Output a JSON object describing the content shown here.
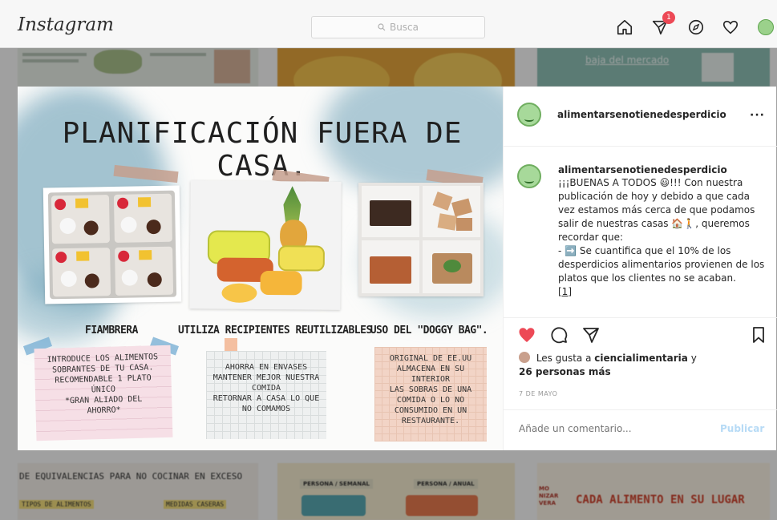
{
  "app": {
    "logo": "Instagram"
  },
  "search": {
    "placeholder": "Busca",
    "icon": "search-icon"
  },
  "nav": {
    "icons": [
      "home-icon",
      "direct-icon",
      "explore-icon",
      "activity-heart-icon",
      "profile-avatar"
    ],
    "direct_badge": "1"
  },
  "post": {
    "image": {
      "headline": "PLANIFICACIÓN FUERA DE CASA.",
      "columns": [
        {
          "title": "FIAMBRERA",
          "note": "INTRODUCE LOS ALIMENTOS\nSOBRANTES DE TU CASA.\nRECOMENDABLE 1 PLATO\nÚNICO\n*GRAN ALIADO DEL\nAHORRO*"
        },
        {
          "title": "UTILIZA RECIPIENTES REUTILIZABLES",
          "note": "AHORRA EN ENVASES\nMANTENER MEJOR NUESTRA\nCOMIDA\nRETORNAR A CASA LO QUE\nNO COMAMOS"
        },
        {
          "title": "USO DEL \"DOGGY BAG\".",
          "note": "ORIGINAL DE EE.UU\nALMACENA EN SU INTERIOR\nLAS SOBRAS DE UNA\nCOMIDA O LO NO\nCONSUMIDO EN UN\nRESTAURANTE."
        }
      ]
    },
    "header": {
      "username": "alimentarsenotienedesperdicio",
      "more_label": "···"
    },
    "caption": {
      "username": "alimentarsenotienedesperdicio",
      "line1": "¡¡¡BUENAS A TODOS 😃!!! Con nuestra publicación de hoy y debido a que cada vez estamos más cerca de que podamos salir de nuestras casas 🏠🚶, queremos recordar que:",
      "line2": "- ➡️ Se cuantifica que el 10% de los desperdicios alimentarios provienen de los platos que los clientes no se acaban.",
      "line3": "[1]"
    },
    "actions": [
      "heart-filled-icon",
      "comment-icon",
      "share-icon",
      "bookmark-icon"
    ],
    "likes": {
      "prefix": "Les gusta a",
      "user": "ciencialimentaria",
      "middle": "y",
      "others": "26 personas más"
    },
    "date": "7 DE MAYO",
    "comment": {
      "placeholder": "Añade un comentario...",
      "publish_label": "Publicar"
    }
  },
  "background": {
    "tiles": [
      {
        "text": "baja del mercado"
      },
      {
        "text": "DE EQUIVALENCIAS PARA NO COCINAR EN EXCESO"
      },
      {
        "text": "TIPOS DE ALIMENTOS"
      },
      {
        "text": "MEDIDAS CASERAS"
      },
      {
        "text": "PERSONA / SEMANAL"
      },
      {
        "text": "PERSONA / ANUAL"
      },
      {
        "text": "CADA ALIMENTO EN SU LUGAR"
      },
      {
        "text": "MO NIZAR VERA"
      }
    ]
  },
  "colors": {
    "like_red": "#ed4956",
    "badge_red": "#ed4956",
    "publish_blue": "#b7dbf6",
    "watercolor_blue": "#6fa3b8"
  }
}
